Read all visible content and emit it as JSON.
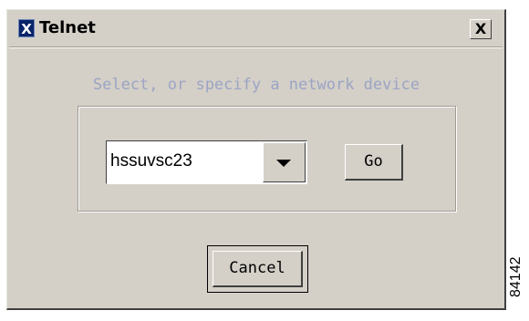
{
  "window": {
    "title": "Telnet",
    "icon_letter": "X",
    "close_label": "X"
  },
  "prompt": "Select, or specify a network device",
  "device_combo": {
    "value": "hssuvsc23",
    "arrow_icon": "chevron-down-icon"
  },
  "buttons": {
    "go_label": "Go",
    "cancel_label": "Cancel"
  },
  "figure_id": "84142",
  "colors": {
    "dialog_bg": "#d4d0c8",
    "prompt_text": "#9ca4c4",
    "icon_bg": "#0a246a"
  }
}
